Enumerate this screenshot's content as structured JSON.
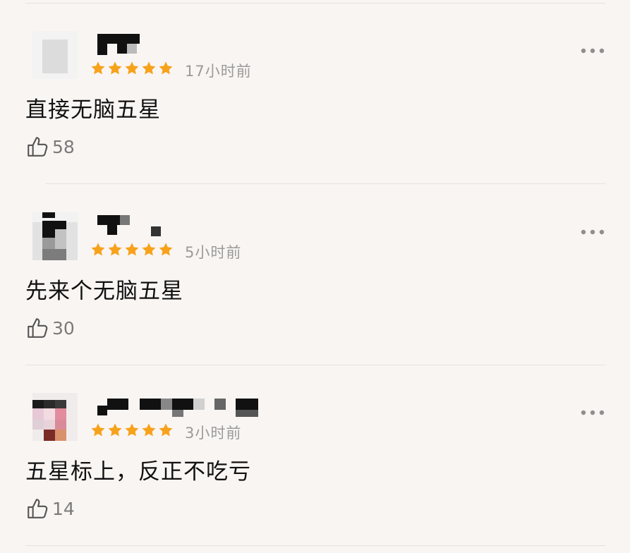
{
  "colors": {
    "background": "#f9f5f3",
    "star": "#f7a21b",
    "time_text": "#9a9a9a",
    "count_text": "#7a7a7a",
    "divider": "#e6e1df"
  },
  "icons": {
    "star": "star-icon",
    "like": "thumbs-up-icon",
    "more": "more-icon"
  },
  "comments": [
    {
      "rating": 5,
      "time": "17小时前",
      "text": "直接无脑五星",
      "likes": "58"
    },
    {
      "rating": 5,
      "time": "5小时前",
      "text": "先来个无脑五星",
      "likes": "30"
    },
    {
      "rating": 5,
      "time": "3小时前",
      "text": "五星标上，反正不吃亏",
      "likes": "14"
    }
  ]
}
